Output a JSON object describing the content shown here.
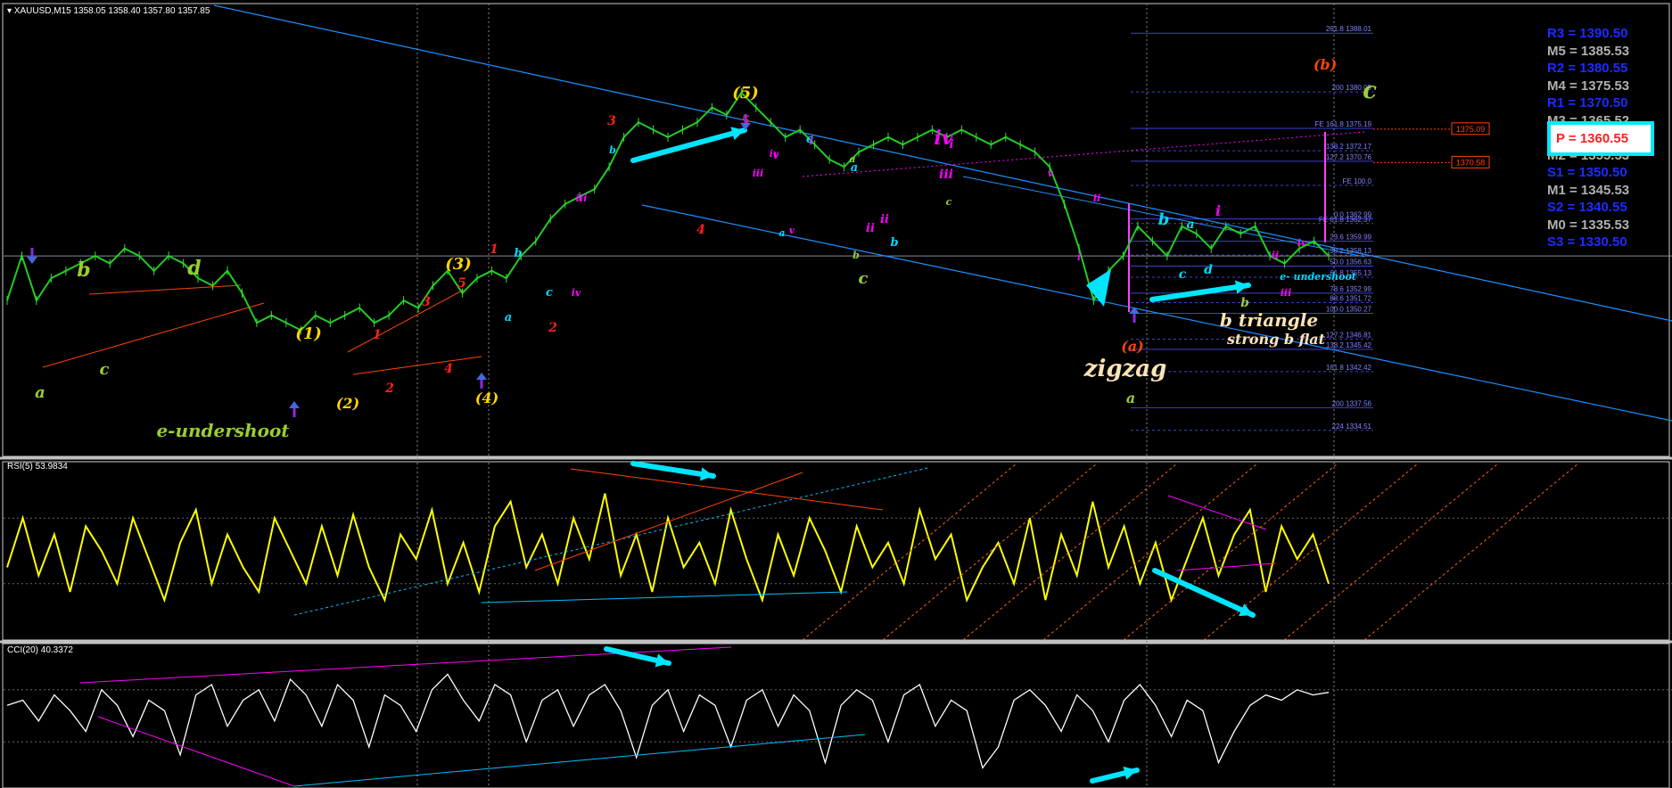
{
  "header": {
    "symbol": "XAUUSD,M15",
    "ohlc": "1358.05 1358.40 1357.80 1357.85",
    "rsi_label": "RSI(5) 53.9834",
    "cci_label": "CCI(20) 40.3372"
  },
  "pivots": [
    {
      "label": "R3 = 1390.50",
      "kind": "r"
    },
    {
      "label": "M5 = 1385.53",
      "kind": "m"
    },
    {
      "label": "R2 = 1380.55",
      "kind": "r"
    },
    {
      "label": "M4 = 1375.53",
      "kind": "m"
    },
    {
      "label": "R1 = 1370.50",
      "kind": "r"
    },
    {
      "label": "M3 = 1365.52",
      "kind": "m"
    },
    {
      "label": "P  = 1360.55",
      "kind": "p"
    },
    {
      "label": "M2 = 1355.53",
      "kind": "m"
    },
    {
      "label": "S1 = 1350.50",
      "kind": "s"
    },
    {
      "label": "M1 = 1345.53",
      "kind": "m"
    },
    {
      "label": "S2 = 1340.55",
      "kind": "s"
    },
    {
      "label": "M0 = 1335.53",
      "kind": "m"
    },
    {
      "label": "S3 = 1330.50",
      "kind": "s"
    }
  ],
  "fib_levels": [
    {
      "label": "261.8 1388.01",
      "price": 1388.01
    },
    {
      "label": "200 1380.09",
      "price": 1380.09
    },
    {
      "label": "FE 161.8 1375.19",
      "price": 1375.19
    },
    {
      "label": "138.2 1372.17",
      "price": 1372.17
    },
    {
      "label": "127.2 1370.76",
      "price": 1370.76
    },
    {
      "label": "FE 100.0",
      "price": 1367.5
    },
    {
      "label": "0.0 1362.99",
      "price": 1362.99
    },
    {
      "label": "FE 61.8 1362.37",
      "price": 1362.37
    },
    {
      "label": "23.6 1359.99",
      "price": 1359.99
    },
    {
      "label": "38.2 1358.13",
      "price": 1358.13
    },
    {
      "label": "50.0 1356.63",
      "price": 1356.63
    },
    {
      "label": "61.8 1355.13",
      "price": 1355.13
    },
    {
      "label": "78.6 1352.99",
      "price": 1352.99
    },
    {
      "label": "88.6 1351.72",
      "price": 1351.72
    },
    {
      "label": "100.0 1350.27",
      "price": 1350.27
    },
    {
      "label": "127.2 1346.81",
      "price": 1346.81
    },
    {
      "label": "138.2 1345.42",
      "price": 1345.42
    },
    {
      "label": "161.8 1342.42",
      "price": 1342.42
    },
    {
      "label": "200 1337.56",
      "price": 1337.56
    },
    {
      "label": "224 1334.51",
      "price": 1334.51
    }
  ],
  "price_tags": [
    {
      "label": "1375.09",
      "price": 1375.09
    },
    {
      "label": "1370.58",
      "price": 1370.58
    }
  ],
  "annotations": [
    {
      "text": "a",
      "color": "#9acd32"
    },
    {
      "text": "b",
      "color": "#9acd32"
    },
    {
      "text": "c",
      "color": "#9acd32"
    },
    {
      "text": "d",
      "color": "#9acd32"
    },
    {
      "text": "e-undershoot",
      "color": "#9acd32"
    },
    {
      "text": "(1)",
      "color": "#ffd700"
    },
    {
      "text": "(2)",
      "color": "#ffd700"
    },
    {
      "text": "(3)",
      "color": "#ffd700"
    },
    {
      "text": "(4)",
      "color": "#ffd700"
    },
    {
      "text": "(5)",
      "color": "#ffd700"
    },
    {
      "text": "1",
      "color": "#ff2020"
    },
    {
      "text": "2",
      "color": "#ff2020"
    },
    {
      "text": "3",
      "color": "#ff2020"
    },
    {
      "text": "4",
      "color": "#ff2020"
    },
    {
      "text": "5",
      "color": "#ff2020"
    },
    {
      "text": "1",
      "color": "#ff2020"
    },
    {
      "text": "2",
      "color": "#ff2020"
    },
    {
      "text": "3",
      "color": "#ff2020"
    },
    {
      "text": "4",
      "color": "#ff2020"
    },
    {
      "text": "5",
      "color": "#ff2020"
    },
    {
      "text": "a",
      "color": "#00d8ff"
    },
    {
      "text": "b",
      "color": "#00d8ff"
    },
    {
      "text": "c",
      "color": "#00d8ff"
    },
    {
      "text": "i",
      "color": "#ff00ff"
    },
    {
      "text": "ii",
      "color": "#ff00ff"
    },
    {
      "text": "iii",
      "color": "#ff00ff"
    },
    {
      "text": "iv",
      "color": "#ff00ff"
    },
    {
      "text": "v",
      "color": "#ff00ff"
    },
    {
      "text": "a",
      "color": "#00d8ff"
    },
    {
      "text": "b",
      "color": "#00d8ff"
    },
    {
      "text": "c",
      "color": "#00d8ff"
    },
    {
      "text": "a",
      "color": "#00d8ff"
    },
    {
      "text": "b",
      "color": "#00d8ff"
    },
    {
      "text": "i",
      "color": "#ff00ff"
    },
    {
      "text": "ii",
      "color": "#ff00ff"
    },
    {
      "text": "iii",
      "color": "#ff00ff"
    },
    {
      "text": "iv",
      "color": "#ff00ff"
    },
    {
      "text": "v",
      "color": "#ff00ff"
    },
    {
      "text": "a",
      "color": "#9acd32"
    },
    {
      "text": "b",
      "color": "#9acd32"
    },
    {
      "text": "c",
      "color": "#9acd32"
    },
    {
      "text": "iv",
      "color": "#ff00ff"
    },
    {
      "text": "iii",
      "color": "#ff00ff"
    },
    {
      "text": "ii",
      "color": "#ff00ff"
    },
    {
      "text": "i",
      "color": "#ff00ff"
    },
    {
      "text": "v",
      "color": "#ff00ff"
    },
    {
      "text": "c",
      "color": "#9acd32"
    },
    {
      "text": "(a)",
      "color": "#ff4500"
    },
    {
      "text": "zigzag",
      "color": "#ffe4b5"
    },
    {
      "text": "a",
      "color": "#9acd32"
    },
    {
      "text": "b",
      "color": "#00d8ff"
    },
    {
      "text": "a",
      "color": "#00d8ff"
    },
    {
      "text": "c",
      "color": "#00d8ff"
    },
    {
      "text": "d",
      "color": "#00d8ff"
    },
    {
      "text": "i",
      "color": "#ff00ff"
    },
    {
      "text": "ii",
      "color": "#ff00ff"
    },
    {
      "text": "iii",
      "color": "#ff00ff"
    },
    {
      "text": "iv",
      "color": "#ff00ff"
    },
    {
      "text": "e- undershoot",
      "color": "#00d8ff"
    },
    {
      "text": "b",
      "color": "#9acd32"
    },
    {
      "text": "b triangle",
      "color": "#ffe4b5"
    },
    {
      "text": "strong b flat",
      "color": "#ffe4b5"
    },
    {
      "text": "(b)",
      "color": "#ff4500"
    },
    {
      "text": "c",
      "color": "#9acd32"
    }
  ],
  "chart_data": {
    "type": "line",
    "symbol": "XAUUSD",
    "timeframe": "M15",
    "price_ylim": [
      1331,
      1392
    ],
    "price": [
      1352,
      1358,
      1352,
      1355,
      1356,
      1357,
      1358,
      1357,
      1359,
      1358,
      1356,
      1358,
      1357,
      1355,
      1354,
      1356,
      1353,
      1349,
      1350,
      1349,
      1348,
      1350,
      1349,
      1350,
      1351,
      1349,
      1350,
      1352,
      1351,
      1354,
      1356,
      1353,
      1355,
      1356,
      1355,
      1358,
      1360,
      1363,
      1365,
      1366,
      1367,
      1370,
      1374,
      1376,
      1375,
      1374,
      1375,
      1376,
      1378,
      1377,
      1380,
      1378,
      1376,
      1374,
      1375,
      1373,
      1371,
      1370,
      1372,
      1373,
      1374,
      1373,
      1374,
      1375,
      1374,
      1375,
      1374,
      1373,
      1374,
      1373,
      1372,
      1370,
      1365,
      1359,
      1352,
      1356,
      1358,
      1362,
      1360,
      1358,
      1362,
      1361,
      1359,
      1362,
      1361,
      1362,
      1358,
      1357,
      1359,
      1360,
      1358
    ],
    "rsi_ylim": [
      0,
      100
    ],
    "rsi": [
      40,
      70,
      35,
      60,
      25,
      65,
      50,
      30,
      70,
      45,
      20,
      55,
      75,
      30,
      60,
      40,
      25,
      70,
      50,
      30,
      65,
      35,
      72,
      40,
      20,
      60,
      45,
      75,
      30,
      55,
      25,
      65,
      80,
      40,
      60,
      30,
      70,
      45,
      85,
      35,
      60,
      25,
      70,
      40,
      55,
      30,
      75,
      45,
      20,
      60,
      35,
      70,
      50,
      25,
      65,
      40,
      55,
      30,
      75,
      45,
      60,
      20,
      40,
      55,
      30,
      70,
      20,
      60,
      35,
      80,
      40,
      65,
      30,
      55,
      20,
      45,
      70,
      35,
      60,
      75,
      25,
      65,
      45,
      60,
      30
    ],
    "cci_ylim": [
      -250,
      250
    ],
    "cci": [
      40,
      60,
      -20,
      80,
      20,
      -60,
      100,
      40,
      -80,
      60,
      20,
      -150,
      80,
      120,
      -40,
      60,
      100,
      -20,
      140,
      80,
      -40,
      120,
      60,
      -120,
      80,
      40,
      -60,
      100,
      160,
      60,
      -20,
      120,
      80,
      -100,
      60,
      100,
      -40,
      80,
      120,
      20,
      -160,
      40,
      100,
      -60,
      80,
      40,
      -120,
      60,
      100,
      -40,
      80,
      20,
      -180,
      40,
      100,
      60,
      -100,
      80,
      120,
      -40,
      60,
      20,
      -200,
      -120,
      60,
      100,
      40,
      -60,
      80,
      20,
      -100,
      60,
      120,
      40,
      -80,
      60,
      20,
      -180,
      -60,
      40,
      80,
      60,
      100,
      80,
      90
    ]
  }
}
